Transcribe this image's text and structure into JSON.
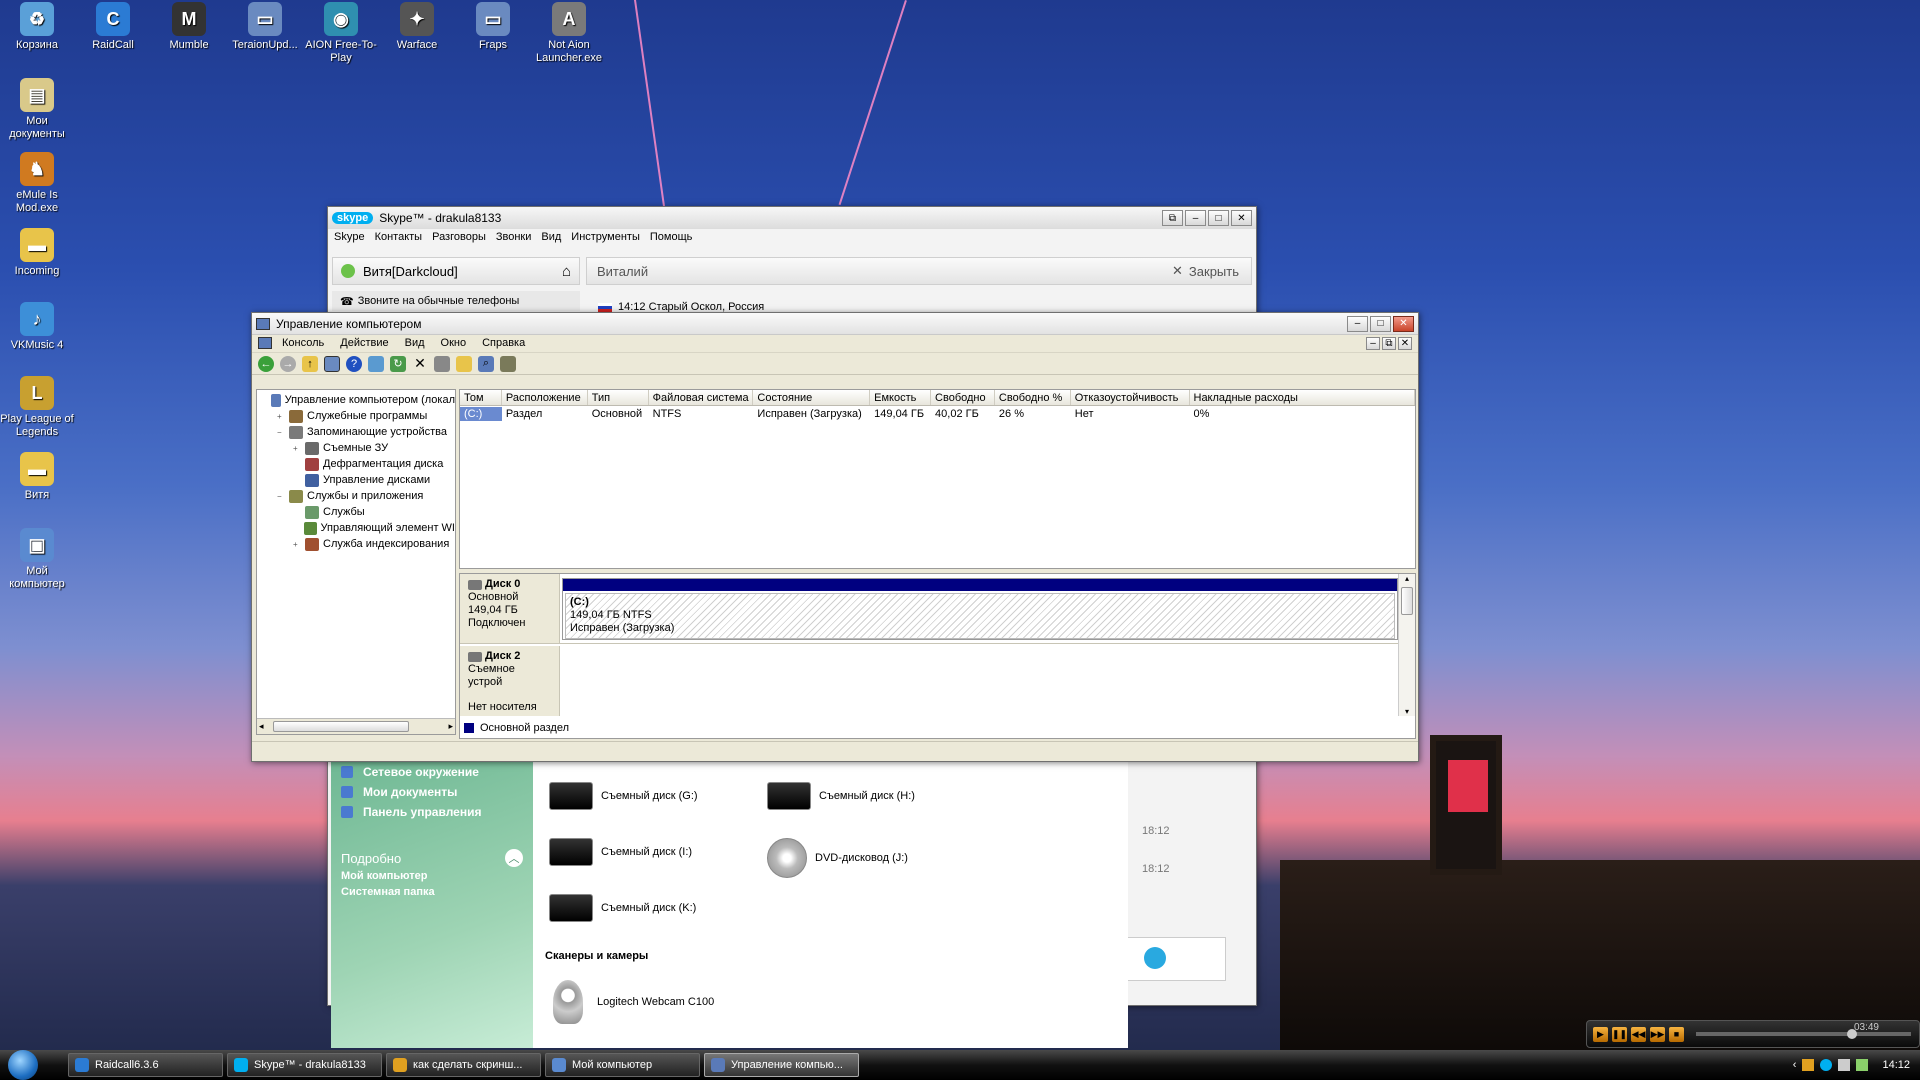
{
  "desktop": {
    "icons": [
      {
        "label": "Корзина",
        "color": "#5aa0d8",
        "glyph": "♻"
      },
      {
        "label": "RaidCall",
        "color": "#2b7bd4",
        "glyph": "C"
      },
      {
        "label": "Mumble",
        "color": "#333333",
        "glyph": "M"
      },
      {
        "label": "TeraionUpd...",
        "color": "#6a8ac0",
        "glyph": "▭"
      },
      {
        "label": "AION Free-To-Play",
        "color": "#2f8fb0",
        "glyph": "◉"
      },
      {
        "label": "Warface",
        "color": "#555555",
        "glyph": "✦"
      },
      {
        "label": "Fraps",
        "color": "#6a8ac0",
        "glyph": "▭"
      },
      {
        "label": "Not Aion Launcher.exe",
        "color": "#7a7a7a",
        "glyph": "A"
      },
      {
        "label": "Мои документы",
        "color": "#d9c98a",
        "glyph": "▤"
      },
      {
        "label": "eMule Is Mod.exe",
        "color": "#d07a20",
        "glyph": "♞"
      },
      {
        "label": "Incoming",
        "color": "#e8c44a",
        "glyph": "▬"
      },
      {
        "label": "VKMusic 4",
        "color": "#3d8fd8",
        "glyph": "♪"
      },
      {
        "label": "Play League of Legends",
        "color": "#c8a030",
        "glyph": "L"
      },
      {
        "label": "Витя",
        "color": "#e8c44a",
        "glyph": "▬"
      },
      {
        "label": "Мой компьютер",
        "color": "#5a8ad0",
        "glyph": "▣"
      }
    ]
  },
  "skype": {
    "title": "Skype™ - drakula8133",
    "logo": "skype",
    "menu": [
      "Skype",
      "Контакты",
      "Разговоры",
      "Звонки",
      "Вид",
      "Инструменты",
      "Помощь"
    ],
    "profile_name": "Витя[Darkcloud]",
    "call_phones": "Звоните на обычные телефоны",
    "contact_name": "Виталий",
    "close_label": "Закрыть",
    "contact_status": "14:12 Старый Оскол, Россия",
    "times": [
      "18:12",
      "18:12"
    ]
  },
  "mgmt": {
    "title": "Управление компьютером",
    "menu": [
      "Консоль",
      "Действие",
      "Вид",
      "Окно",
      "Справка"
    ],
    "tree": [
      {
        "label": "Управление компьютером (локал",
        "level": 0,
        "exp": "",
        "color": "#5a7ab8"
      },
      {
        "label": "Служебные программы",
        "level": 1,
        "exp": "+",
        "color": "#8a6a3a"
      },
      {
        "label": "Запоминающие устройства",
        "level": 1,
        "exp": "−",
        "color": "#7a7a7a"
      },
      {
        "label": "Съемные ЗУ",
        "level": 2,
        "exp": "+",
        "color": "#6a6a6a"
      },
      {
        "label": "Дефрагментация диска",
        "level": 2,
        "exp": "",
        "color": "#a04040"
      },
      {
        "label": "Управление дисками",
        "level": 2,
        "exp": "",
        "color": "#4060a0"
      },
      {
        "label": "Службы и приложения",
        "level": 1,
        "exp": "−",
        "color": "#8a8a4a"
      },
      {
        "label": "Службы",
        "level": 2,
        "exp": "",
        "color": "#6a9a6a"
      },
      {
        "label": "Управляющий элемент WI",
        "level": 2,
        "exp": "",
        "color": "#5a8a3a"
      },
      {
        "label": "Служба индексирования",
        "level": 2,
        "exp": "+",
        "color": "#a05030"
      }
    ],
    "columns": [
      {
        "label": "Том",
        "w": 42
      },
      {
        "label": "Расположение",
        "w": 86
      },
      {
        "label": "Тип",
        "w": 61
      },
      {
        "label": "Файловая система",
        "w": 105
      },
      {
        "label": "Состояние",
        "w": 117
      },
      {
        "label": "Емкость",
        "w": 61
      },
      {
        "label": "Свободно",
        "w": 64
      },
      {
        "label": "Свободно %",
        "w": 76
      },
      {
        "label": "Отказоустойчивость",
        "w": 119
      },
      {
        "label": "Накладные расходы",
        "w": 226
      }
    ],
    "rows": [
      {
        "cells": [
          "(C:)",
          "Раздел",
          "Основной",
          "NTFS",
          "Исправен (Загрузка)",
          "149,04 ГБ",
          "40,02 ГБ",
          "26 %",
          "Нет",
          "0%"
        ]
      }
    ],
    "disk0": {
      "name": "Диск 0",
      "type": "Основной",
      "size": "149,04 ГБ",
      "status": "Подключен",
      "part_label": "(C:)",
      "part_size": "149,04 ГБ NTFS",
      "part_status": "Исправен (Загрузка)"
    },
    "disk2": {
      "name": "Диск 2",
      "type": "Съемное устрой",
      "status": "Нет носителя"
    },
    "legend": "Основной раздел",
    "legend_color": "#000080"
  },
  "explorer": {
    "tasks": [
      "Сетевое окружение",
      "Мои документы",
      "Панель управления"
    ],
    "details_header": "Подробно",
    "details_name": "Мой компьютер",
    "details_type": "Системная папка",
    "drives": [
      "Съемный диск (G:)",
      "Съемный диск (H:)",
      "Съемный диск (I:)",
      "DVD-дисковод (J:)",
      "Съемный диск (K:)"
    ],
    "section_scanners": "Сканеры и камеры",
    "webcam": "Logitech Webcam C100"
  },
  "taskbar": {
    "tasks": [
      {
        "label": "Raidcall6.3.6",
        "color": "#2b7bd4"
      },
      {
        "label": "Skype™ - drakula8133",
        "color": "#00aff0"
      },
      {
        "label": "как сделать скринш...",
        "color": "#e0a020"
      },
      {
        "label": "Мой компьютер",
        "color": "#5a8ad0"
      },
      {
        "label": "Управление компью...",
        "color": "#5a7ab8"
      }
    ],
    "clock": "14:12",
    "player_time": "03:49"
  }
}
